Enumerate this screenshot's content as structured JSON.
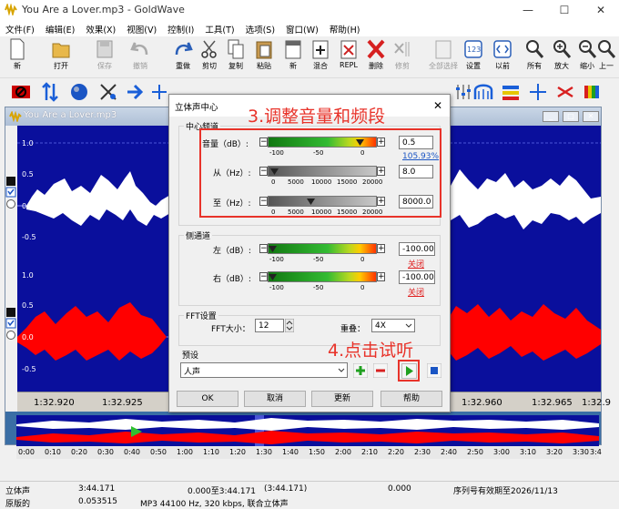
{
  "window": {
    "title": "You Are a Lover.mp3 - GoldWave",
    "minimize": "—",
    "maximize": "☐",
    "close": "✕"
  },
  "menu": [
    "文件(F)",
    "编辑(E)",
    "效果(X)",
    "视图(V)",
    "控制(I)",
    "工具(T)",
    "选项(S)",
    "窗口(W)",
    "帮助(H)"
  ],
  "toolbar": [
    {
      "label": "新",
      "icon": "new-file-icon"
    },
    {
      "label": "打开",
      "icon": "open-folder-icon"
    },
    {
      "label": "保存",
      "icon": "save-disk-icon"
    },
    {
      "label": "撤销",
      "icon": "undo-icon"
    },
    {
      "label": "重做",
      "icon": "redo-icon"
    },
    {
      "label": "剪切",
      "icon": "scissors-icon"
    },
    {
      "label": "复制",
      "icon": "copy-icon"
    },
    {
      "label": "粘贴",
      "icon": "paste-icon"
    },
    {
      "label": "新",
      "icon": "paste-new-icon"
    },
    {
      "label": "混合",
      "icon": "mix-icon"
    },
    {
      "label": "REPL",
      "icon": "replace-icon"
    },
    {
      "label": "删除",
      "icon": "delete-x-icon"
    },
    {
      "label": "修剪",
      "icon": "trim-icon"
    },
    {
      "label": "全部选择",
      "icon": "select-all-icon"
    },
    {
      "label": "设置",
      "icon": "set-icon"
    },
    {
      "label": "以前",
      "icon": "previous-icon"
    },
    {
      "label": "所有",
      "icon": "zoom-all-icon"
    },
    {
      "label": "放大",
      "icon": "zoom-in-icon"
    },
    {
      "label": "缩小",
      "icon": "zoom-out-icon"
    },
    {
      "label": "上一",
      "icon": "zoom-previous-icon"
    }
  ],
  "wave_window": {
    "title": "You Are a Lover.mp3",
    "y_labels": [
      "1.0",
      "0.5",
      "0.0",
      "-0.5",
      "1.0",
      "0.5",
      "0.0",
      "-0.5"
    ],
    "timeline": [
      "1:32.920",
      "1:32.925",
      "1:32.960",
      "1:32.965",
      "1:32.9"
    ]
  },
  "overview_ticks": [
    "0:00",
    "0:10",
    "0:20",
    "0:30",
    "0:40",
    "0:50",
    "1:00",
    "1:10",
    "1:20",
    "1:30",
    "1:40",
    "1:50",
    "2:00",
    "2:10",
    "2:20",
    "2:30",
    "2:40",
    "2:50",
    "3:00",
    "3:10",
    "3:20",
    "3:30",
    "3:4"
  ],
  "dialog": {
    "title": "立体声中心",
    "close": "✕",
    "center_group": "中心频道",
    "volume_label": "音量（dB）:",
    "volume_value": "0.5",
    "volume_percent": "105.93%",
    "volume_ticks": [
      "-100",
      "-50",
      "0"
    ],
    "from_label": "从（Hz）:",
    "from_value": "8.0",
    "freq_ticks": [
      "0",
      "5000",
      "10000",
      "15000",
      "20000"
    ],
    "to_label": "至（Hz）:",
    "to_value": "8000.0",
    "side_group": "侧通道",
    "left_label": "左（dB）:",
    "left_value": "-100.00",
    "left_status": "关闭",
    "right_label": "右（dB）:",
    "right_value": "-100.00",
    "right_status": "关闭",
    "fft_group": "FFT设置",
    "fft_label": "FFT大小：",
    "fft_value": "12",
    "overlap_label": "重叠：",
    "overlap_value": "4X",
    "preset_label": "预设",
    "preset_value": "人声",
    "ok": "OK",
    "cancel": "取消",
    "update": "更新",
    "help": "帮助"
  },
  "annotations": {
    "step3": "3.调整音量和频段",
    "step4": "4.点击试听"
  },
  "status": {
    "row1": [
      "立体声",
      "3:44.171",
      "0.000至3:44.171",
      "(3:44.171)",
      "0.000",
      "序列号有效期至2026/11/13"
    ],
    "row2": [
      "原版的",
      "0.053515",
      "MP3 44100 Hz, 320 kbps, 联合立体声"
    ]
  },
  "colors": {
    "wave_bg": "#0a0f9c",
    "top_channel": "#ffffff",
    "bottom_channel": "#ff0000",
    "annotation": "#e8332a",
    "accent_link": "#1a55c4"
  }
}
